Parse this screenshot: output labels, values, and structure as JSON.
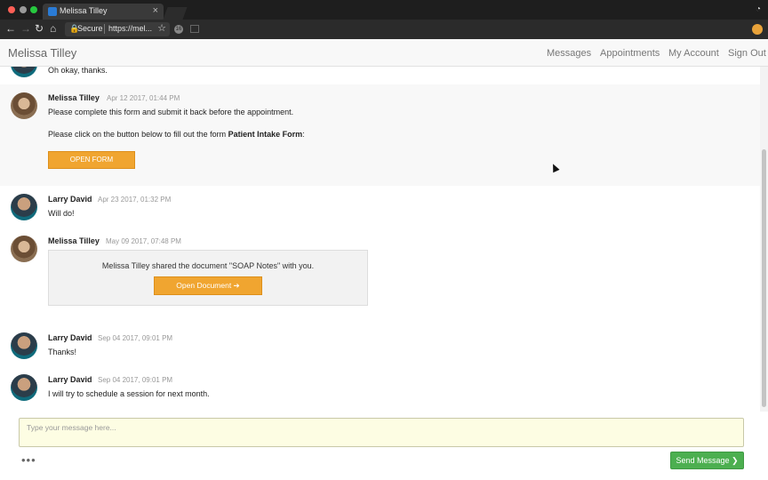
{
  "browser": {
    "tab_title": "Melissa Tilley",
    "secure_label": "Secure",
    "url": "https://mel...",
    "ext_badge": "16"
  },
  "navbar": {
    "brand": "Melissa Tilley",
    "links": [
      "Messages",
      "Appointments",
      "My Account",
      "Sign Out"
    ]
  },
  "messages": [
    {
      "text": "Oh okay, thanks."
    },
    {
      "sender": "Melissa Tilley",
      "timestamp": "Apr 12 2017, 01:44 PM",
      "line1": "Please complete this form and submit it back before the appointment.",
      "line2_prefix": "Please click on the button below to fill out the form ",
      "form_name": "Patient Intake Form",
      "line2_suffix": ":",
      "button": "OPEN FORM"
    },
    {
      "sender": "Larry David",
      "timestamp": "Apr 23 2017, 01:32 PM",
      "text": "Will do!"
    },
    {
      "sender": "Melissa Tilley",
      "timestamp": "May 09 2017, 07:48 PM",
      "doc_text": "Melissa Tilley shared the document \"SOAP Notes\" with you.",
      "button": "Open Document ➔"
    },
    {
      "sender": "Larry David",
      "timestamp": "Sep 04 2017, 09:01 PM",
      "text": "Thanks!"
    },
    {
      "sender": "Larry David",
      "timestamp": "Sep 04 2017, 09:01 PM",
      "text": "I will try to schedule a session for next month."
    }
  ],
  "composer": {
    "placeholder": "Type your message here...",
    "dots": "•••",
    "send_label": "Send Message ❯"
  }
}
